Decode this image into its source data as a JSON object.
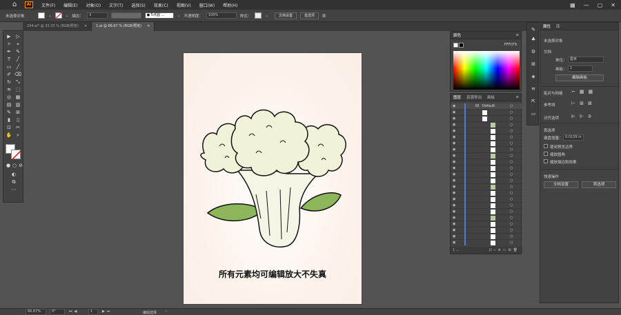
{
  "menu": {
    "logo": "Ai",
    "items": [
      "文件(F)",
      "编辑(E)",
      "对象(O)",
      "文字(T)",
      "选择(S)",
      "效果(C)",
      "视图(V)",
      "窗口(W)",
      "帮助(H)"
    ]
  },
  "control": {
    "selection": "未选择对象",
    "stroke_label": "描边：",
    "brush": "● 5点圆 ...",
    "opacity_label": "不透明度：",
    "opacity": "100%",
    "style_label": "样式：",
    "doc_setup": "文档设置",
    "prefs": "首选项"
  },
  "tabs": [
    {
      "label": "244.ai* @ 33.33 % (RGB/预览)"
    },
    {
      "label": "1.ai @ 66.67 % (RGB/预览)"
    }
  ],
  "artboard": {
    "caption": "所有元素均可编辑放大不失真"
  },
  "color_panel": {
    "title": "颜色",
    "hex": "FFFCF9"
  },
  "layers_panel": {
    "tabs": [
      "图层",
      "资源导出",
      "画板"
    ],
    "layer_name": "Default",
    "footer": "1 ..."
  },
  "properties": {
    "tabs": [
      "属性",
      "库"
    ],
    "selection": "未选择对象",
    "doc_section": "文档",
    "units_label": "单位：",
    "units": "厘米",
    "artboard_label": "画板：",
    "artboard_value": "1",
    "edit_artboards": "编辑画板",
    "snap_label": "贴对与网格",
    "guides_label": "参考线",
    "align_label": "对齐选项",
    "prefs_section": "首选项",
    "keyboard_inc_label": "键盘增量：",
    "keyboard_inc": "0.0139 in",
    "cb1": "使用预览边界",
    "cb2": "缩放圆角",
    "cb3": "缩放描边和效果",
    "quick_section": "快速操作",
    "doc_setup": "文档设置",
    "prefs": "首选项"
  },
  "status": {
    "zoom": "66.67%",
    "angle": "0°",
    "page": "1",
    "tool": "编组选择"
  },
  "colors": {
    "leaf": "#8db55a",
    "floret": "#f2f2d8",
    "stem": "#f5f5e6",
    "outline": "#111111",
    "accent": "#ff9a00"
  }
}
